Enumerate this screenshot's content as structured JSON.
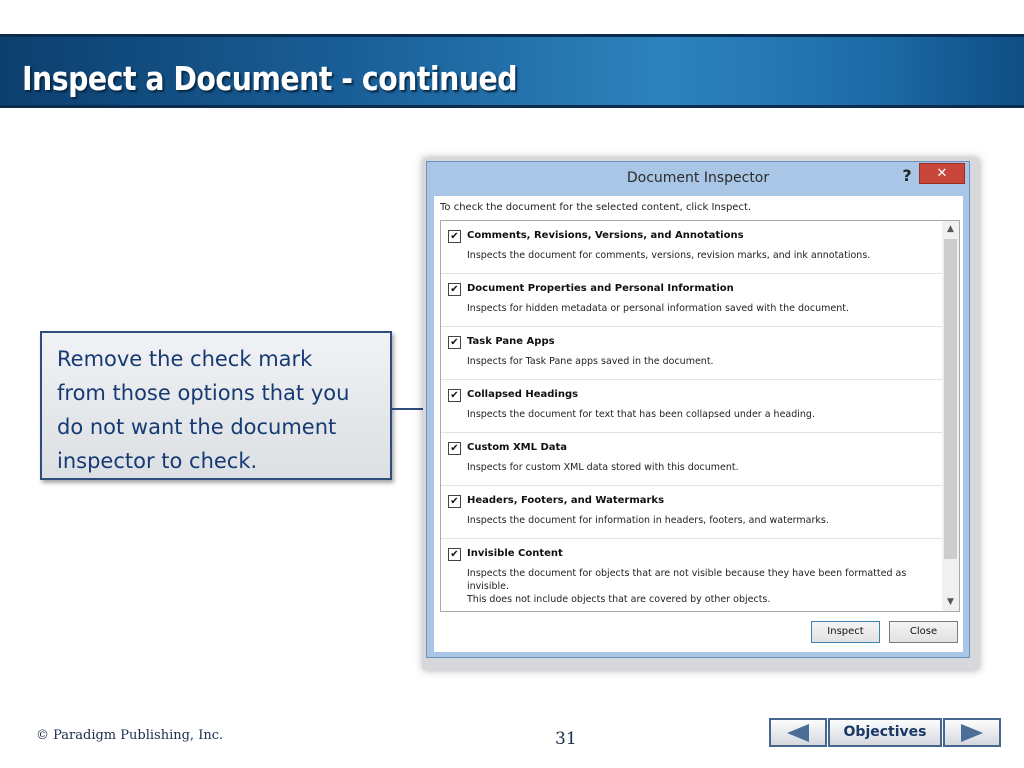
{
  "slide": {
    "title": "Inspect a Document - continued",
    "callout_lines": [
      "Remove the check mark",
      "from those options that you",
      "do not want the document",
      "inspector to check."
    ],
    "copyright": "© Paradigm Publishing, Inc.",
    "page_number": "31",
    "nav": {
      "objectives_label": "Objectives"
    }
  },
  "dialog": {
    "title": "Document Inspector",
    "help_label": "?",
    "close_label": "✕",
    "instruction": "To check the document for the selected content, click Inspect.",
    "check_mark": "✔",
    "items": [
      {
        "title": "Comments, Revisions, Versions, and Annotations",
        "desc": "Inspects the document for comments, versions, revision marks, and ink annotations.",
        "checked": true
      },
      {
        "title": "Document Properties and Personal Information",
        "desc": "Inspects for hidden metadata or personal information saved with the document.",
        "checked": true
      },
      {
        "title": "Task Pane Apps",
        "desc": "Inspects for Task Pane apps saved in the document.",
        "checked": true
      },
      {
        "title": "Collapsed Headings",
        "desc": "Inspects the document for text that has been collapsed under a heading.",
        "checked": true
      },
      {
        "title": "Custom XML Data",
        "desc": "Inspects for custom XML data stored with this document.",
        "checked": true
      },
      {
        "title": "Headers, Footers, and Watermarks",
        "desc": "Inspects the document for information in headers, footers, and watermarks.",
        "checked": true
      },
      {
        "title": "Invisible Content",
        "desc": "Inspects the document for objects that are not visible because they have been formatted as invisible.",
        "desc2": "This does not include objects that are covered by other objects.",
        "checked": true
      }
    ],
    "buttons": {
      "inspect": "Inspect",
      "close": "Close"
    }
  }
}
